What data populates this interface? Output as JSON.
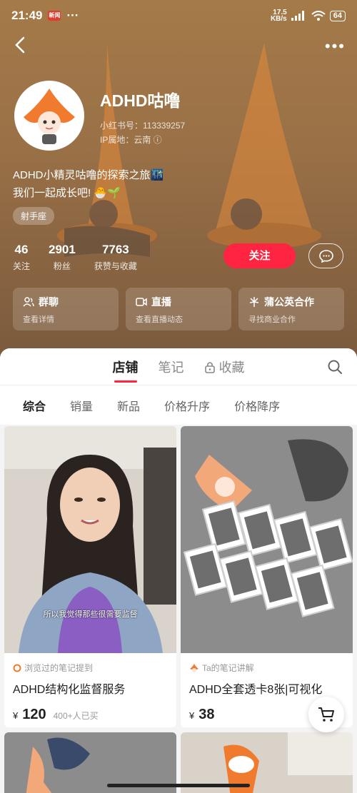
{
  "status_bar": {
    "time": "21:49",
    "news_badge": "新闻",
    "dots": "···",
    "net_speed_value": "17.5",
    "net_speed_unit": "KB/s",
    "battery": "64"
  },
  "nav": {
    "more": "•••"
  },
  "profile": {
    "nickname": "ADHD咕噜",
    "redbook_id": "小红书号：113339257",
    "ip_location": "IP属地：云南 ⓘ",
    "bio_line1": "ADHD小精灵咕噜的探索之旅🌃",
    "bio_line2": "我们一起成长吧! 🐣🌱",
    "tag": "射手座"
  },
  "stats": [
    {
      "num": "46",
      "label": "关注"
    },
    {
      "num": "2901",
      "label": "粉丝"
    },
    {
      "num": "7763",
      "label": "获赞与收藏"
    }
  ],
  "actions": {
    "follow": "关注"
  },
  "cards": [
    {
      "title": "群聊",
      "sub": "查看详情",
      "icon": "group-icon"
    },
    {
      "title": "直播",
      "sub": "查看直播动态",
      "icon": "live-icon"
    },
    {
      "title": "蒲公英合作",
      "sub": "寻找商业合作",
      "icon": "dandelion-icon"
    }
  ],
  "tabs": [
    {
      "label": "店铺",
      "active": true
    },
    {
      "label": "笔记",
      "active": false
    },
    {
      "label": "收藏",
      "active": false,
      "icon": "lock-icon"
    }
  ],
  "sort": [
    "综合",
    "销量",
    "新品",
    "价格升序",
    "价格降序"
  ],
  "products": [
    {
      "hint": "浏览过的笔记提到",
      "title": "ADHD结构化监督服务",
      "yen": "¥",
      "price": "120",
      "sold": "400+人已买",
      "subtitle": "所以我觉得那些很需要监督"
    },
    {
      "hint": "Ta的笔记讲解",
      "title": "ADHD全套透卡8张|可视化",
      "yen": "¥",
      "price": "38"
    }
  ],
  "colors": {
    "accent": "#ff2442",
    "header_bg": "#9a7147"
  }
}
